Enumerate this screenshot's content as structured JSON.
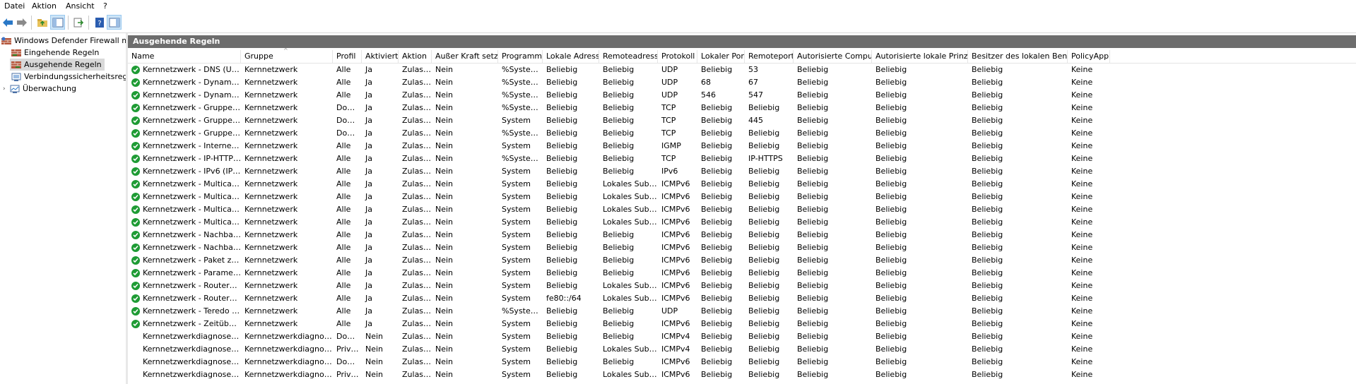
{
  "menu": [
    "Datei",
    "Aktion",
    "Ansicht",
    "?"
  ],
  "toolbar": {
    "icons": [
      "back-arrow-icon",
      "forward-arrow-icon",
      "folder-up-icon",
      "show-hide-tree-icon",
      "export-list-icon",
      "help-icon",
      "action-pane-icon"
    ]
  },
  "tree": {
    "root": "Windows Defender Firewall mit",
    "items": [
      "Eingehende Regeln",
      "Ausgehende Regeln",
      "Verbindungssicherheitsrege",
      "Überwachung"
    ],
    "selected_index": 1
  },
  "pane_title": "Ausgehende Regeln",
  "columns": [
    "Name",
    "Gruppe",
    "Profil",
    "Aktiviert",
    "Aktion",
    "Außer Kraft setzen",
    "Programm",
    "Lokale Adresse",
    "Remoteadresse",
    "Protokoll",
    "Lokaler Port",
    "Remoteport",
    "Autorisierte Computer",
    "Autorisierte lokale Prinzipale",
    "Besitzer des lokalen Benutzers",
    "PolicyAppId"
  ],
  "rows": [
    {
      "enabled": true,
      "cells": [
        "Kernnetzwerk - DNS (UDP ausgehend)",
        "Kernnetzwerk",
        "Alle",
        "Ja",
        "Zulassen",
        "Nein",
        "%SystemRo...",
        "Beliebig",
        "Beliebig",
        "UDP",
        "Beliebig",
        "53",
        "Beliebig",
        "Beliebig",
        "Beliebig",
        "Keine"
      ]
    },
    {
      "enabled": true,
      "cells": [
        "Kernnetzwerk - Dynamic Host Configurati...",
        "Kernnetzwerk",
        "Alle",
        "Ja",
        "Zulassen",
        "Nein",
        "%SystemRo...",
        "Beliebig",
        "Beliebig",
        "UDP",
        "68",
        "67",
        "Beliebig",
        "Beliebig",
        "Beliebig",
        "Keine"
      ]
    },
    {
      "enabled": true,
      "cells": [
        "Kernnetzwerk - Dynamic Host Configurati...",
        "Kernnetzwerk",
        "Alle",
        "Ja",
        "Zulassen",
        "Nein",
        "%SystemRo...",
        "Beliebig",
        "Beliebig",
        "UDP",
        "546",
        "547",
        "Beliebig",
        "Beliebig",
        "Beliebig",
        "Keine"
      ]
    },
    {
      "enabled": true,
      "cells": [
        "Kernnetzwerk - Gruppenrichtlinie (LSASS a...",
        "Kernnetzwerk",
        "Domä...",
        "Ja",
        "Zulassen",
        "Nein",
        "%SystemRo...",
        "Beliebig",
        "Beliebig",
        "TCP",
        "Beliebig",
        "Beliebig",
        "Beliebig",
        "Beliebig",
        "Beliebig",
        "Keine"
      ]
    },
    {
      "enabled": true,
      "cells": [
        "Kernnetzwerk - Gruppenrichtlinie (NP aus...",
        "Kernnetzwerk",
        "Domä...",
        "Ja",
        "Zulassen",
        "Nein",
        "System",
        "Beliebig",
        "Beliebig",
        "TCP",
        "Beliebig",
        "445",
        "Beliebig",
        "Beliebig",
        "Beliebig",
        "Keine"
      ]
    },
    {
      "enabled": true,
      "cells": [
        "Kernnetzwerk - Gruppenrichtlinie (TCP aus...",
        "Kernnetzwerk",
        "Domä...",
        "Ja",
        "Zulassen",
        "Nein",
        "%SystemRo...",
        "Beliebig",
        "Beliebig",
        "TCP",
        "Beliebig",
        "Beliebig",
        "Beliebig",
        "Beliebig",
        "Beliebig",
        "Keine"
      ]
    },
    {
      "enabled": true,
      "cells": [
        "Kernnetzwerk - Internetgruppenverwaltun...",
        "Kernnetzwerk",
        "Alle",
        "Ja",
        "Zulassen",
        "Nein",
        "System",
        "Beliebig",
        "Beliebig",
        "IGMP",
        "Beliebig",
        "Beliebig",
        "Beliebig",
        "Beliebig",
        "Beliebig",
        "Keine"
      ]
    },
    {
      "enabled": true,
      "cells": [
        "Kernnetzwerk - IP-HTTPS (TCP ausgehend)",
        "Kernnetzwerk",
        "Alle",
        "Ja",
        "Zulassen",
        "Nein",
        "%SystemRo...",
        "Beliebig",
        "Beliebig",
        "TCP",
        "Beliebig",
        "IP-HTTPS",
        "Beliebig",
        "Beliebig",
        "Beliebig",
        "Keine"
      ]
    },
    {
      "enabled": true,
      "cells": [
        "Kernnetzwerk - IPv6 (IPv6 ausgehend)",
        "Kernnetzwerk",
        "Alle",
        "Ja",
        "Zulassen",
        "Nein",
        "System",
        "Beliebig",
        "Beliebig",
        "IPv6",
        "Beliebig",
        "Beliebig",
        "Beliebig",
        "Beliebig",
        "Beliebig",
        "Keine"
      ]
    },
    {
      "enabled": true,
      "cells": [
        "Kernnetzwerk - Multicastabhörabfrage (IC...",
        "Kernnetzwerk",
        "Alle",
        "Ja",
        "Zulassen",
        "Nein",
        "System",
        "Beliebig",
        "Lokales Subnetz",
        "ICMPv6",
        "Beliebig",
        "Beliebig",
        "Beliebig",
        "Beliebig",
        "Beliebig",
        "Keine"
      ]
    },
    {
      "enabled": true,
      "cells": [
        "Kernnetzwerk - Multicastabhörbericht (IC...",
        "Kernnetzwerk",
        "Alle",
        "Ja",
        "Zulassen",
        "Nein",
        "System",
        "Beliebig",
        "Lokales Subnetz",
        "ICMPv6",
        "Beliebig",
        "Beliebig",
        "Beliebig",
        "Beliebig",
        "Beliebig",
        "Keine"
      ]
    },
    {
      "enabled": true,
      "cells": [
        "Kernnetzwerk - Multicastabhörbericht v2 (...",
        "Kernnetzwerk",
        "Alle",
        "Ja",
        "Zulassen",
        "Nein",
        "System",
        "Beliebig",
        "Lokales Subnetz",
        "ICMPv6",
        "Beliebig",
        "Beliebig",
        "Beliebig",
        "Beliebig",
        "Beliebig",
        "Keine"
      ]
    },
    {
      "enabled": true,
      "cells": [
        "Kernnetzwerk - Multicastabhörvorgang a...",
        "Kernnetzwerk",
        "Alle",
        "Ja",
        "Zulassen",
        "Nein",
        "System",
        "Beliebig",
        "Lokales Subnetz",
        "ICMPv6",
        "Beliebig",
        "Beliebig",
        "Beliebig",
        "Beliebig",
        "Beliebig",
        "Keine"
      ]
    },
    {
      "enabled": true,
      "cells": [
        "Kernnetzwerk - Nachbarermittlungsanfra...",
        "Kernnetzwerk",
        "Alle",
        "Ja",
        "Zulassen",
        "Nein",
        "System",
        "Beliebig",
        "Beliebig",
        "ICMPv6",
        "Beliebig",
        "Beliebig",
        "Beliebig",
        "Beliebig",
        "Beliebig",
        "Keine"
      ]
    },
    {
      "enabled": true,
      "cells": [
        "Kernnetzwerk - Nachbarermittlungsankün...",
        "Kernnetzwerk",
        "Alle",
        "Ja",
        "Zulassen",
        "Nein",
        "System",
        "Beliebig",
        "Beliebig",
        "ICMPv6",
        "Beliebig",
        "Beliebig",
        "Beliebig",
        "Beliebig",
        "Beliebig",
        "Keine"
      ]
    },
    {
      "enabled": true,
      "cells": [
        "Kernnetzwerk - Paket zu groß (ICMPv6 aus...",
        "Kernnetzwerk",
        "Alle",
        "Ja",
        "Zulassen",
        "Nein",
        "System",
        "Beliebig",
        "Beliebig",
        "ICMPv6",
        "Beliebig",
        "Beliebig",
        "Beliebig",
        "Beliebig",
        "Beliebig",
        "Keine"
      ]
    },
    {
      "enabled": true,
      "cells": [
        "Kernnetzwerk - Parameterproblem (ICMPv...",
        "Kernnetzwerk",
        "Alle",
        "Ja",
        "Zulassen",
        "Nein",
        "System",
        "Beliebig",
        "Beliebig",
        "ICMPv6",
        "Beliebig",
        "Beliebig",
        "Beliebig",
        "Beliebig",
        "Beliebig",
        "Keine"
      ]
    },
    {
      "enabled": true,
      "cells": [
        "Kernnetzwerk - Routeranfrage (ICMPv6 au...",
        "Kernnetzwerk",
        "Alle",
        "Ja",
        "Zulassen",
        "Nein",
        "System",
        "Beliebig",
        "Lokales Subnetz,...",
        "ICMPv6",
        "Beliebig",
        "Beliebig",
        "Beliebig",
        "Beliebig",
        "Beliebig",
        "Keine"
      ]
    },
    {
      "enabled": true,
      "cells": [
        "Kernnetzwerk - Routerankündigung (ICM...",
        "Kernnetzwerk",
        "Alle",
        "Ja",
        "Zulassen",
        "Nein",
        "System",
        "fe80::/64",
        "Lokales Subnetz,...",
        "ICMPv6",
        "Beliebig",
        "Beliebig",
        "Beliebig",
        "Beliebig",
        "Beliebig",
        "Keine"
      ]
    },
    {
      "enabled": true,
      "cells": [
        "Kernnetzwerk - Teredo (UDP ausgehend)",
        "Kernnetzwerk",
        "Alle",
        "Ja",
        "Zulassen",
        "Nein",
        "%SystemRo...",
        "Beliebig",
        "Beliebig",
        "UDP",
        "Beliebig",
        "Beliebig",
        "Beliebig",
        "Beliebig",
        "Beliebig",
        "Keine"
      ]
    },
    {
      "enabled": true,
      "cells": [
        "Kernnetzwerk - Zeitüberschreitung (ICMP...",
        "Kernnetzwerk",
        "Alle",
        "Ja",
        "Zulassen",
        "Nein",
        "System",
        "Beliebig",
        "Beliebig",
        "ICMPv6",
        "Beliebig",
        "Beliebig",
        "Beliebig",
        "Beliebig",
        "Beliebig",
        "Keine"
      ]
    },
    {
      "enabled": false,
      "cells": [
        "Kernnetzwerkdiagnose – ICMP-Echoanfor...",
        "Kernnetzwerkdiagnose",
        "Domä...",
        "Nein",
        "Zulassen",
        "Nein",
        "System",
        "Beliebig",
        "Beliebig",
        "ICMPv4",
        "Beliebig",
        "Beliebig",
        "Beliebig",
        "Beliebig",
        "Beliebig",
        "Keine"
      ]
    },
    {
      "enabled": false,
      "cells": [
        "Kernnetzwerkdiagnose – ICMP-Echoanfor...",
        "Kernnetzwerkdiagnose",
        "Privat,...",
        "Nein",
        "Zulassen",
        "Nein",
        "System",
        "Beliebig",
        "Lokales Subnetz",
        "ICMPv4",
        "Beliebig",
        "Beliebig",
        "Beliebig",
        "Beliebig",
        "Beliebig",
        "Keine"
      ]
    },
    {
      "enabled": false,
      "cells": [
        "Kernnetzwerkdiagnose – ICMP-Echoanfor...",
        "Kernnetzwerkdiagnose",
        "Domä...",
        "Nein",
        "Zulassen",
        "Nein",
        "System",
        "Beliebig",
        "Beliebig",
        "ICMPv6",
        "Beliebig",
        "Beliebig",
        "Beliebig",
        "Beliebig",
        "Beliebig",
        "Keine"
      ]
    },
    {
      "enabled": false,
      "cells": [
        "Kernnetzwerkdiagnose – ICMP-Echoanfor...",
        "Kernnetzwerkdiagnose",
        "Privat,...",
        "Nein",
        "Zulassen",
        "Nein",
        "System",
        "Beliebig",
        "Lokales Subnetz",
        "ICMPv6",
        "Beliebig",
        "Beliebig",
        "Beliebig",
        "Beliebig",
        "Beliebig",
        "Keine"
      ]
    }
  ],
  "colors": {
    "enabled_check": "#1e9b34",
    "title_bar": "#6d6d6d",
    "selection": "#d9d9d9"
  }
}
